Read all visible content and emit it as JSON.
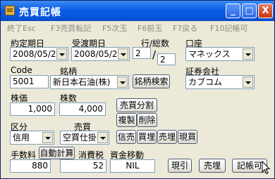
{
  "window": {
    "title": "売買記帳"
  },
  "titlebar_buttons": {
    "minimize": "_",
    "maximize": "□",
    "close": "X"
  },
  "menu": {
    "items": [
      "終了Esc",
      "F3売買転記",
      "F5次玉",
      "F6前玉",
      "F7戻る",
      "F10記帳可"
    ]
  },
  "form": {
    "contract_date": {
      "label": "約定期日",
      "value": "2008/05/26"
    },
    "delivery_date": {
      "label": "受渡期日",
      "value": "2008/05/29"
    },
    "lot": {
      "label": "行/総数",
      "row": "2",
      "slash": "/",
      "total": "2"
    },
    "account": {
      "label": "口座",
      "value": "マネックス"
    },
    "code": {
      "label": "Code",
      "value": "5001"
    },
    "brand": {
      "label": "銘柄",
      "value": "新日本石油(株)",
      "search_button": "銘柄検索"
    },
    "broker": {
      "label": "証券会社",
      "value": "カブコム"
    },
    "price": {
      "label": "株価",
      "value": "1,000"
    },
    "quantity": {
      "label": "株数",
      "value": "4,000"
    },
    "category": {
      "label": "区分",
      "value": "信用"
    },
    "trade": {
      "label": "売買",
      "value": "空買仕掛"
    },
    "fee": {
      "label": "手数料",
      "value": "880"
    },
    "auto_calc_button": "自動計算",
    "consumption_tax": {
      "label": "消費税",
      "value": "52"
    },
    "fund_transfer": {
      "label": "資金移動",
      "value": "NIL"
    }
  },
  "buttons": {
    "split": "売買分割",
    "duplicate": "複製",
    "delete": "削除",
    "credit_repay": "信売",
    "repay_buy": "買埋",
    "sell": "売埋",
    "spot": "現買",
    "current_cancel": "現引",
    "sell_repay": "売埋",
    "bookkeeping_ok": "記帳可"
  },
  "colors": {
    "titlebar": "#0a5ce6",
    "window_bg": "#ece9d8",
    "disabled_text": "#8e8c80",
    "input_border": "#7f9db9"
  },
  "icons": [
    "app-icon",
    "minimize-icon",
    "maximize-icon",
    "close-icon",
    "mouse-cursor-icon"
  ]
}
